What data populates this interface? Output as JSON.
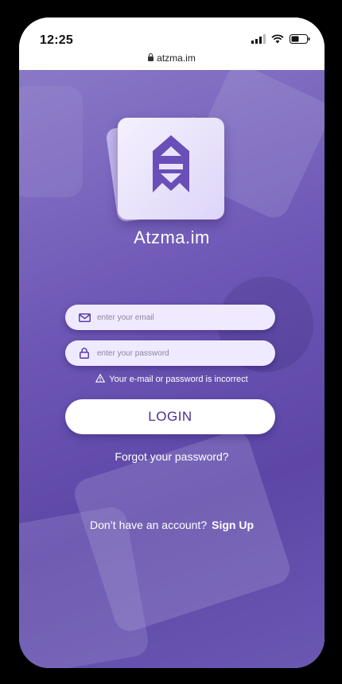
{
  "status_bar": {
    "time": "12:25"
  },
  "browser": {
    "url": "atzma.im"
  },
  "app": {
    "name": "Atzma.im"
  },
  "form": {
    "email_placeholder": "enter your email",
    "password_placeholder": "enter your password",
    "error_message": "Your e-mail or password is incorrect",
    "login_label": "LOGIN",
    "forgot_label": "Forgot your password?",
    "no_account_text": "Don’t have an account?",
    "signup_label": "Sign Up"
  },
  "colors": {
    "accent": "#5d46a6",
    "button_text": "#4b2f95"
  },
  "icons": [
    "signal-icon",
    "wifi-icon",
    "battery-icon",
    "lock-icon",
    "logo-icon",
    "mail-icon",
    "password-lock-icon",
    "warning-icon"
  ]
}
